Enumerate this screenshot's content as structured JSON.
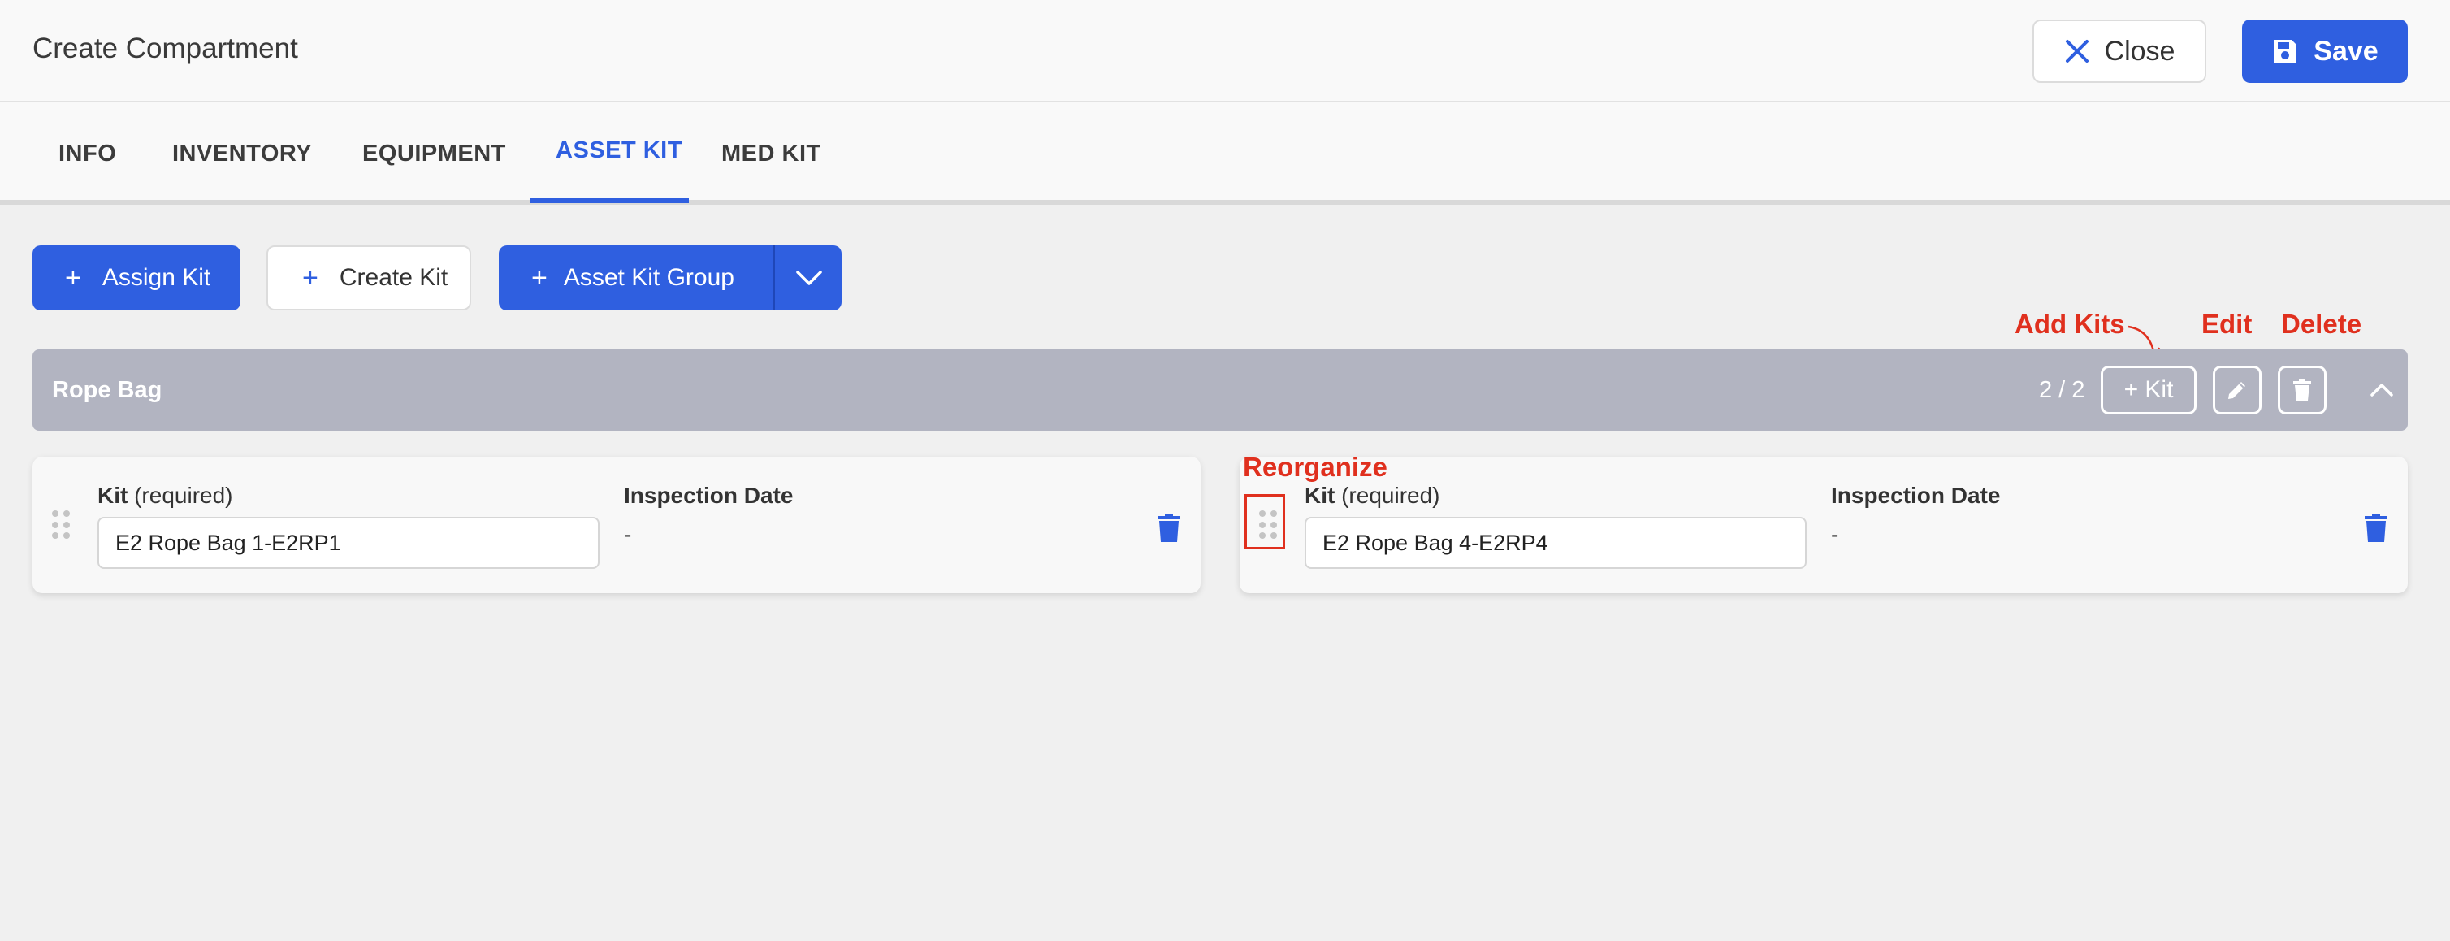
{
  "header": {
    "title": "Create Compartment",
    "close_label": "Close",
    "save_label": "Save"
  },
  "tabs": [
    {
      "label": "INFO",
      "active": false
    },
    {
      "label": "INVENTORY",
      "active": false
    },
    {
      "label": "EQUIPMENT",
      "active": false
    },
    {
      "label": "ASSET KIT",
      "active": true
    },
    {
      "label": "MED KIT",
      "active": false
    }
  ],
  "actions": {
    "assign_kit": "Assign Kit",
    "create_kit": "Create Kit",
    "asset_kit_group": "Asset Kit Group",
    "plus": "+"
  },
  "group": {
    "title": "Rope Bag",
    "count": "2 / 2",
    "add_kit_label": "+ Kit"
  },
  "annotations": {
    "add_kits": "Add Kits",
    "edit": "Edit",
    "delete": "Delete",
    "reorganize": "Reorganize"
  },
  "kits": [
    {
      "kit_label": "Kit",
      "kit_required": "(required)",
      "kit_value": "E2 Rope Bag 1-E2RP1",
      "inspection_label": "Inspection Date",
      "inspection_value": "-"
    },
    {
      "kit_label": "Kit",
      "kit_required": "(required)",
      "kit_value": "E2 Rope Bag 4-E2RP4",
      "inspection_label": "Inspection Date",
      "inspection_value": "-"
    }
  ],
  "colors": {
    "primary": "#2f5fe0",
    "group_bar": "#b2b4c1",
    "annotation": "#e0301e",
    "background": "#f0f0f0"
  }
}
